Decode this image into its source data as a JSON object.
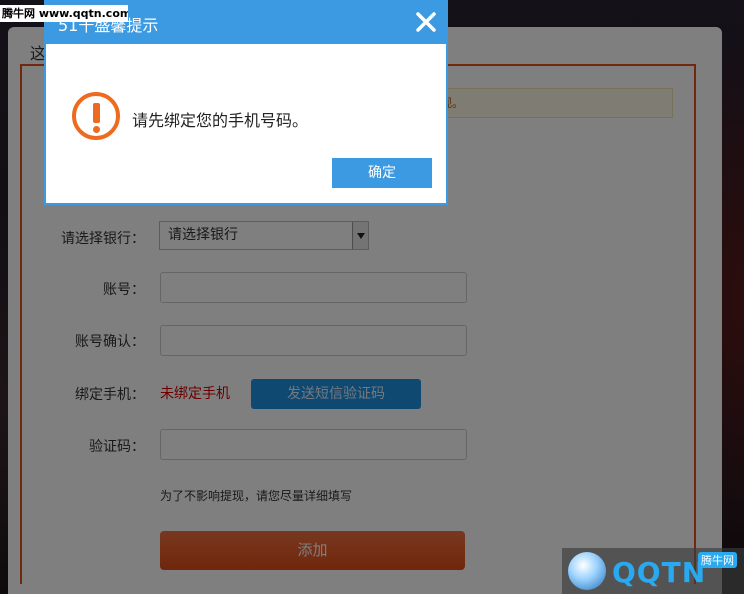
{
  "dialog": {
    "title": "51千盛馨提示",
    "message": "请先绑定您的手机号码。",
    "ok_label": "确定"
  },
  "panel": {
    "tab_title": "这",
    "notice_text": "观。"
  },
  "form": {
    "bank_label": "请选择银行：",
    "bank_selected": "请选择银行",
    "account_label": "账号：",
    "account_confirm_label": "账号确认：",
    "phone_label": "绑定手机：",
    "phone_status": "未绑定手机",
    "sms_button": "发送短信验证码",
    "code_label": "验证码：",
    "hint": "为了不影响提现，请您尽量详细填写",
    "add_button": "添加"
  },
  "watermark": {
    "top_text": "腾牛网 www.qqtn.com",
    "logo_text": "QQTN",
    "logo_sub": "腾牛网"
  },
  "colors": {
    "accent_blue": "#3b9ae1",
    "warning_orange": "#ee6a1e",
    "error_red": "#d40000",
    "add_orange": "#e04e18"
  }
}
